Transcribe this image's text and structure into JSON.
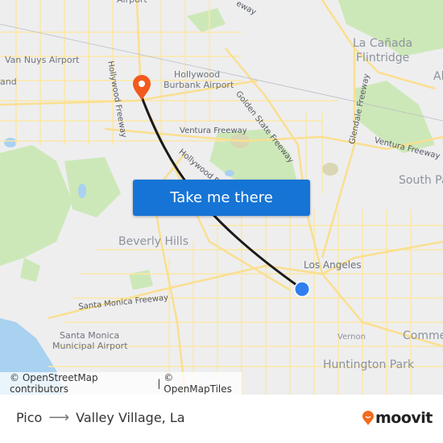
{
  "map": {
    "labels": {
      "van_nuys_airport": "Van Nuys Airport",
      "hollywood_burbank_airport_1": "Hollywood",
      "hollywood_burbank_airport_2": "Burbank Airport",
      "airport_top": "Airport",
      "la_canada_1": "La Cañada",
      "la_canada_2": "Flintridge",
      "altadena_partial": "Al",
      "south_pasadena_partial": "South Pa",
      "hollywood_freeway_north": "Hollywood Freeway",
      "golden_state_freeway": "Golden State Freeway",
      "ventura_freeway_west": "Ventura Freeway",
      "ventura_freeway_east": "Ventura Freeway",
      "glendale_freeway": "Glendale Freeway",
      "hollywood_freeway_south": "Hollywood Fr",
      "freeway_top": "eway",
      "beverly_hills": "Beverly Hills",
      "santa_monica_freeway": "Santa Monica Freeway",
      "santa_monica_airport_1": "Santa Monica",
      "santa_monica_airport_2": "Municipal Airport",
      "los_angeles": "Los Angeles",
      "vernon": "Vernon",
      "commerce_partial": "Comme",
      "huntington_park": "Huntington Park",
      "left_partial": "and"
    },
    "origin_marker": "Pico",
    "destination_marker": "Valley Village, La",
    "colors": {
      "route": "#1a1a1a",
      "origin": "#2f7ff0",
      "destination": "#f25a1d",
      "roads": "#fbe6a0",
      "park": "#c8e6b0",
      "water": "#a8d0ee"
    }
  },
  "cta": {
    "label": "Take me there"
  },
  "attribution": {
    "osm": "© OpenStreetMap contributors",
    "separator": " | ",
    "omt": "© OpenMapTiles"
  },
  "footer": {
    "origin": "Pico",
    "arrow": "⟶",
    "destination": "Valley Village, La",
    "brand": "moovit",
    "brand_color": "#f26a1d"
  }
}
